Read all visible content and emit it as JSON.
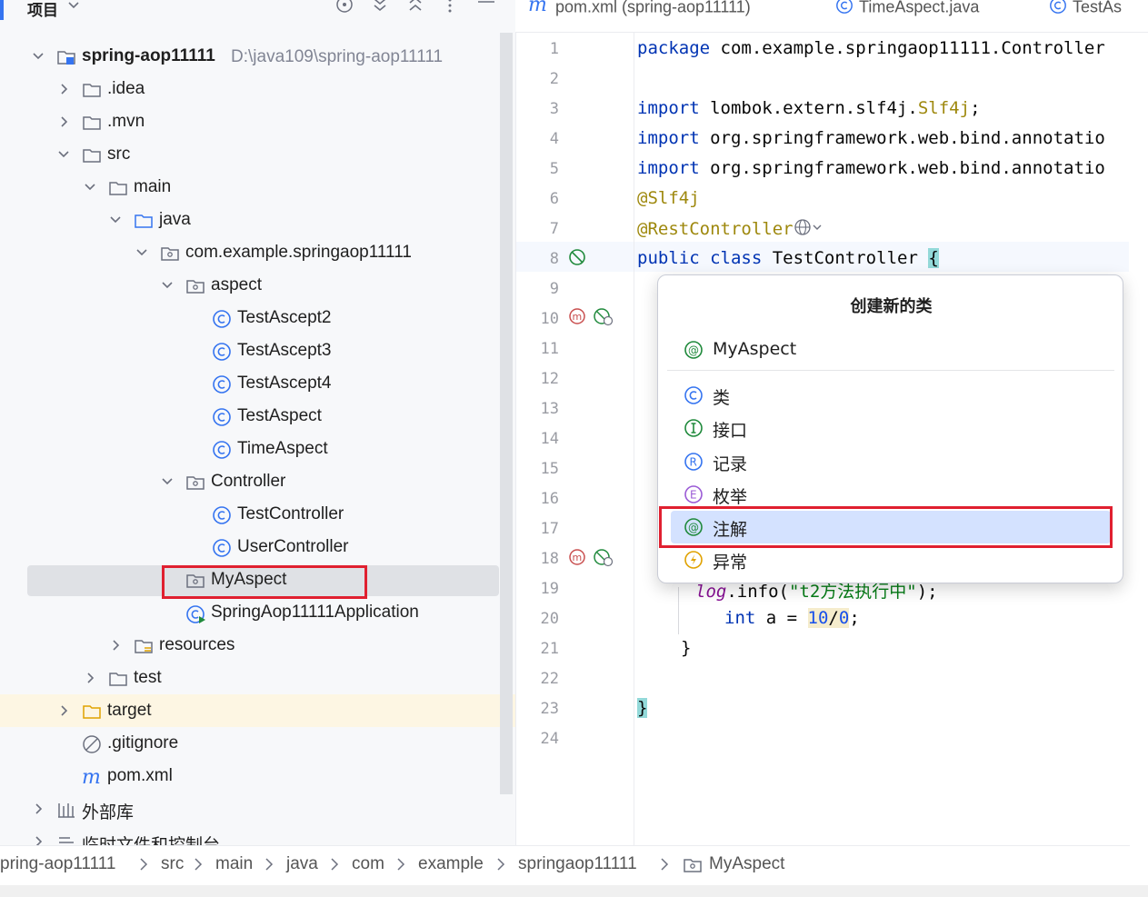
{
  "panel": {
    "title": "项目"
  },
  "tree": {
    "root_label": "spring-aop11111",
    "root_path": "D:\\java109\\spring-aop11111",
    "idea": ".idea",
    "mvn": ".mvn",
    "src": "src",
    "main": "main",
    "java": "java",
    "package": "com.example.springaop11111",
    "aspect": "aspect",
    "aspect_classes": [
      "TestAscept2",
      "TestAscept3",
      "TestAscept4",
      "TestAspect",
      "TimeAspect"
    ],
    "controller": "Controller",
    "controller_classes": [
      "TestController",
      "UserController"
    ],
    "myaspect": "MyAspect",
    "application": "SpringAop11111Application",
    "resources": "resources",
    "test": "test",
    "target": "target",
    "gitignore": ".gitignore",
    "pom": "pom.xml",
    "external_libs": "外部库",
    "scratches": "临时文件和控制台"
  },
  "tabs": [
    "pom.xml (spring-aop11111)",
    "TimeAspect.java",
    "TestAs"
  ],
  "editor": {
    "line_numbers": [
      "1",
      "2",
      "3",
      "4",
      "5",
      "6",
      "7",
      "8",
      "9",
      "10",
      "11",
      "12",
      "13",
      "14",
      "15",
      "16",
      "17",
      "18",
      "19",
      "20",
      "21",
      "22",
      "23",
      "24"
    ],
    "l1_kw": "package",
    "l1_rest": " com.example.springaop11111.Controller",
    "l3_kw": "import",
    "l3_rest": " lombok.extern.slf4j.",
    "l3_ann": "Slf4j",
    "l3_end": ";",
    "l4_kw": "import",
    "l4_rest": " org.springframework.web.bind.annotatio",
    "l5_kw": "import",
    "l5_rest": " org.springframework.web.bind.annotatio",
    "l6_ann": "@Slf4j",
    "l7_ann": "@RestController",
    "l8_kw1": "public",
    "l8_kw2": "class",
    "l8_rest": " TestController ",
    "l8_brace": "{",
    "l19_field": "log",
    "l19_mid": ".info(",
    "l19_str": "\"t2方法执行中\"",
    "l19_end": ");",
    "l20_kw": "int",
    "l20_var": " a = ",
    "l20_num1": "10",
    "l20_op": "/",
    "l20_num2": "0",
    "l20_end": ";",
    "l21_brace": "}",
    "l23_brace": "}"
  },
  "popup": {
    "title": "创建新的类",
    "recent_item": "MyAspect",
    "items": [
      "类",
      "接口",
      "记录",
      "枚举",
      "注解",
      "异常"
    ],
    "selected": "注解"
  },
  "breadcrumb": [
    "pring-aop11111",
    "src",
    "main",
    "java",
    "com",
    "example",
    "springaop11111",
    "MyAspect"
  ],
  "colors": {
    "accent": "#3574f0",
    "selection": "#d4e2ff",
    "highlight_box": "#e02030",
    "class_icon": "#3574f0",
    "interface_icon": "#208a3c",
    "enum_icon": "#9b5bd6",
    "exception_icon": "#e0a200"
  }
}
